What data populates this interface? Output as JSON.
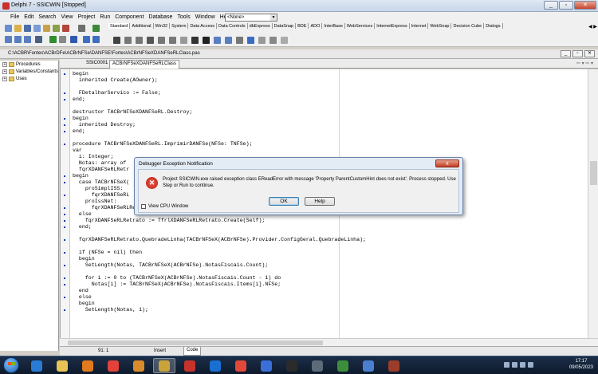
{
  "window": {
    "title": "Delphi 7 - SSICWIN [Stopped]"
  },
  "menu": {
    "items": [
      "File",
      "Edit",
      "Search",
      "View",
      "Project",
      "Run",
      "Component",
      "Database",
      "Tools",
      "Window",
      "Help"
    ]
  },
  "toolbar": {
    "desktop_select": "<None>"
  },
  "palette": {
    "tabs": [
      "Standard",
      "Additional",
      "Win32",
      "System",
      "Data Access",
      "Data Controls",
      "dbExpress",
      "DataSnap",
      "BDE",
      "ADO",
      "InterBase",
      "WebServices",
      "InternetExpress",
      "Internet",
      "WebSnap",
      "Decision Cube",
      "Dialogs"
    ],
    "selected_tab": "Standard"
  },
  "path_bar": {
    "path": "C:\\ACBR\\Fontes\\ACBrDFe\\ACBrNFSe\\DANFSE\\Fortes\\ACBrNFSeXDANFSeRLClass.pas"
  },
  "tree": {
    "items": [
      "Procedures",
      "Variables/Constants",
      "Uses"
    ]
  },
  "editor": {
    "tabs": [
      "SSIC0001",
      "ACBrNFSeXDANFSeRLClass"
    ],
    "selected_tab": "ACBrNFSeXDANFSeRLClass",
    "lines": [
      "begin",
      "  inherited Create(AOwner);",
      "",
      "  FDetalharServico := False;",
      "end;",
      "",
      "destructor TACBrNFSeXDANFSeRL.Destroy;",
      "begin",
      "  inherited Destroy;",
      "end;",
      "",
      "procedure TACBrNFSeXDANFSeRL.ImprimirDANFSe(NFSe: TNFSe);",
      "var",
      "  i: Integer;",
      "  Notas: array of",
      "  fqrXDANFSeRLRetr",
      "begin",
      "  case TACBrNFSeX(",
      "    proSimplISS:",
      "      fqrXDANFSeRL",
      "    proIssNet:",
      "      fqrXDANFSeRLRetrato := TfrlXDANFSeRLISSNet.Create(Self);",
      "  else",
      "    fqrXDANFSeRLRetrato := TfrlXDANFSeRLRetrato.Create(Self);",
      "  end;",
      "",
      "  fqrXDANFSeRLRetrato.QuebradeLinha(TACBrNFSeX(ACBrNFSe).Provider.ConfigGeral.QuebradeLinha);",
      "",
      "  if (NFSe = nil) then",
      "  begin",
      "    SetLength(Notas, TACBrNFSeX(ACBrNFSe).NotasFiscais.Count);",
      "",
      "    for i := 0 to (TACBrNFSeX(ACBrNFSe).NotasFiscais.Count - 1) do",
      "      Notas[i] := TACBrNFSeX(ACBrNFSe).NotasFiscais.Items[i].NFSe;",
      "  end",
      "  else",
      "  begin",
      "    SetLength(Notas, 1);"
    ],
    "breakpoint_dot_lines": [
      0,
      3,
      4,
      7,
      8,
      9,
      11,
      16,
      17,
      19,
      21,
      22,
      23,
      24,
      26,
      28,
      30,
      32,
      33,
      35,
      37
    ]
  },
  "status": {
    "position": "91: 1",
    "mode": "Insert",
    "view_tab": "Code"
  },
  "dialog": {
    "title": "Debugger Exception Notification",
    "close_label": "x",
    "message": "Project SSICWIN.exe raised exception class EReadError with message 'Property ParentCustomHint does not exist'. Process stopped. Use Step or Run to continue.",
    "ok_label": "OK",
    "help_label": "Help",
    "checkbox_label": "View CPU Window",
    "checkbox_checked": false
  },
  "taskbar": {
    "time": "17:17",
    "date": "09/05/2023",
    "apps": [
      {
        "icon": "ie-icon",
        "color": "#2a7bd6"
      },
      {
        "icon": "explorer-icon",
        "color": "#e8c455"
      },
      {
        "icon": "media-player-icon",
        "color": "#e07a1f"
      },
      {
        "icon": "chrome-icon",
        "color": "#e3423a"
      },
      {
        "icon": "firefox-icon",
        "color": "#d98b2b"
      },
      {
        "icon": "delphi-icon",
        "color": "#c9a43a"
      },
      {
        "icon": "app-red-icon",
        "color": "#c8322c"
      },
      {
        "icon": "teamviewer-icon",
        "color": "#1a6fd2"
      },
      {
        "icon": "anydesk-icon",
        "color": "#e2483a"
      },
      {
        "icon": "search-app-icon",
        "color": "#3b6fd8"
      },
      {
        "icon": "terminal-icon",
        "color": "#2b2b2b"
      },
      {
        "icon": "pdf-icon",
        "color": "#5c6a7a"
      },
      {
        "icon": "app-green-icon",
        "color": "#3c8f3a"
      },
      {
        "icon": "notes-icon",
        "color": "#4a7fcf"
      },
      {
        "icon": "firebird-icon",
        "color": "#9b3d2a"
      }
    ]
  }
}
